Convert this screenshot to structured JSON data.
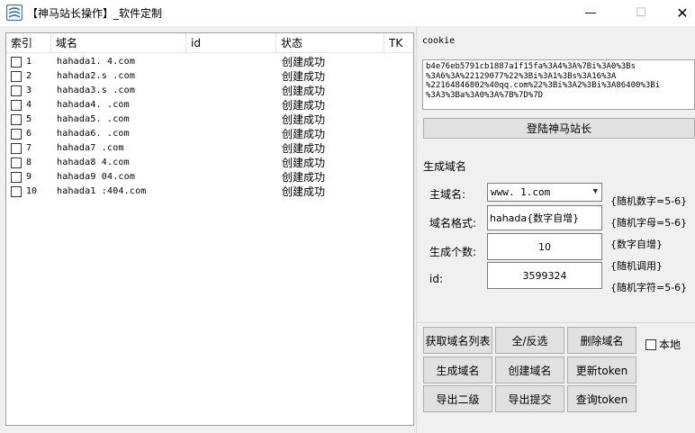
{
  "window": {
    "title": "【神马站长操作】_软件定制",
    "minimize_glyph": "—",
    "maximize_glyph": "☐",
    "close_glyph": "✕"
  },
  "list": {
    "columns": [
      "索引",
      "域名",
      "id",
      "状态",
      "TK"
    ],
    "rows": [
      {
        "index": "1",
        "domain": "hahada1.    4.com",
        "status": "创建成功"
      },
      {
        "index": "2",
        "domain": "hahada2.s    .com",
        "status": "创建成功"
      },
      {
        "index": "3",
        "domain": "hahada3.s    .com",
        "status": "创建成功"
      },
      {
        "index": "4",
        "domain": "hahada4.     .com",
        "status": "创建成功"
      },
      {
        "index": "5",
        "domain": "hahada5.     .com",
        "status": "创建成功"
      },
      {
        "index": "6",
        "domain": "hahada6.     .com",
        "status": "创建成功"
      },
      {
        "index": "7",
        "domain": "hahada7      .com",
        "status": "创建成功"
      },
      {
        "index": "8",
        "domain": "hahada8    4.com",
        "status": "创建成功"
      },
      {
        "index": "9",
        "domain": "hahada9    04.com",
        "status": "创建成功"
      },
      {
        "index": "10",
        "domain": "hahada1   :404.com",
        "status": "创建成功"
      }
    ]
  },
  "cookie": {
    "label": "cookie",
    "value": "b4e76eb5791cb1887a1f15fa%3A4%3A%7Bi%3A0%3Bs\n%3A6%3A%22129077%22%3Bi%3A1%3Bs%3A16%3A\n%22164846802%40qq.com%22%3Bi%3A2%3Bi%3A86400%3Bi\n%3A3%3Ba%3A0%3A%7B%7D%7D"
  },
  "buttons": {
    "login": "登陆神马站长",
    "get_list": "获取域名列表",
    "select_all": "全/反选",
    "delete": "删除域名",
    "generate": "生成域名",
    "create": "创建域名",
    "update_token": "更新token",
    "export_second": "导出二级",
    "export_submit": "导出提交",
    "query_token": "查询token"
  },
  "generate": {
    "section_label": "生成域名",
    "main_domain_label": "主域名:",
    "main_domain_value": "www.      1.com",
    "format_label": "域名格式:",
    "format_value": "hahada{数字自增}",
    "count_label": "生成个数:",
    "count_value": "10",
    "id_label": "id:",
    "id_value": "3599324",
    "hints": [
      "{随机数字=5-6}",
      "{随机字母=5-6}",
      "{数字自增}",
      "{随机调用}",
      "{随机字符=5-6}"
    ]
  },
  "local": {
    "label": "本地"
  }
}
